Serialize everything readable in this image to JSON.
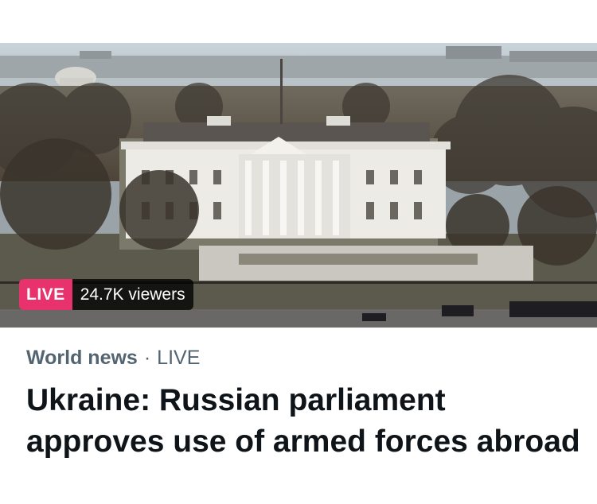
{
  "media": {
    "image_alt_icon": "white-house-photo",
    "live_label": "LIVE",
    "viewers_label": "24.7K viewers"
  },
  "meta": {
    "category": "World news",
    "separator": "·",
    "status": "LIVE"
  },
  "headline": "Ukraine: Russian parliament approves use of armed forces abroad",
  "colors": {
    "live_accent": "#e8326e",
    "meta_text": "#536471",
    "headline_text": "#0f1419"
  }
}
